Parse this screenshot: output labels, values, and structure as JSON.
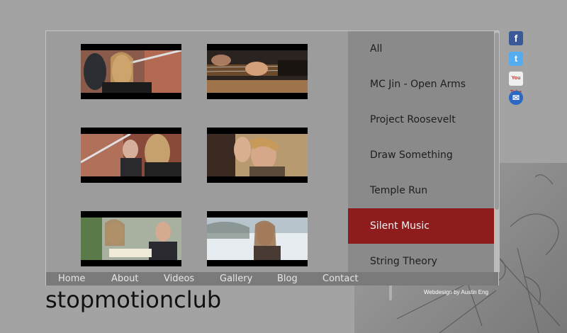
{
  "site": {
    "logo_text": "stopmotionclub",
    "credit": "Webdesign by Austin Eng"
  },
  "categories": [
    {
      "label": "All"
    },
    {
      "label": "MC Jin - Open Arms"
    },
    {
      "label": "Project Roosevelt"
    },
    {
      "label": "Draw Something"
    },
    {
      "label": "Temple Run"
    },
    {
      "label": "Silent Music",
      "active": true
    },
    {
      "label": "String Theory"
    }
  ],
  "nav": [
    {
      "label": "Home"
    },
    {
      "label": "About"
    },
    {
      "label": "Videos"
    },
    {
      "label": "Gallery"
    },
    {
      "label": "Blog"
    },
    {
      "label": "Contact"
    }
  ],
  "social": [
    {
      "icon": "facebook-icon",
      "glyph": "f"
    },
    {
      "icon": "twitter-icon",
      "glyph": "t"
    },
    {
      "icon": "youtube-icon",
      "glyph": "You Tube"
    },
    {
      "icon": "email-icon",
      "glyph": "✉"
    }
  ],
  "thumbnails": [
    {
      "scene": "two people on stairs"
    },
    {
      "scene": "guitar close-up"
    },
    {
      "scene": "pair at railing"
    },
    {
      "scene": "boy close-up"
    },
    {
      "scene": "reading a book"
    },
    {
      "scene": "girl in snow"
    }
  ],
  "colors": {
    "background": "#a3a3a3",
    "active_category": "#8f1c1c",
    "nav_bar": "#7a7a7a"
  }
}
